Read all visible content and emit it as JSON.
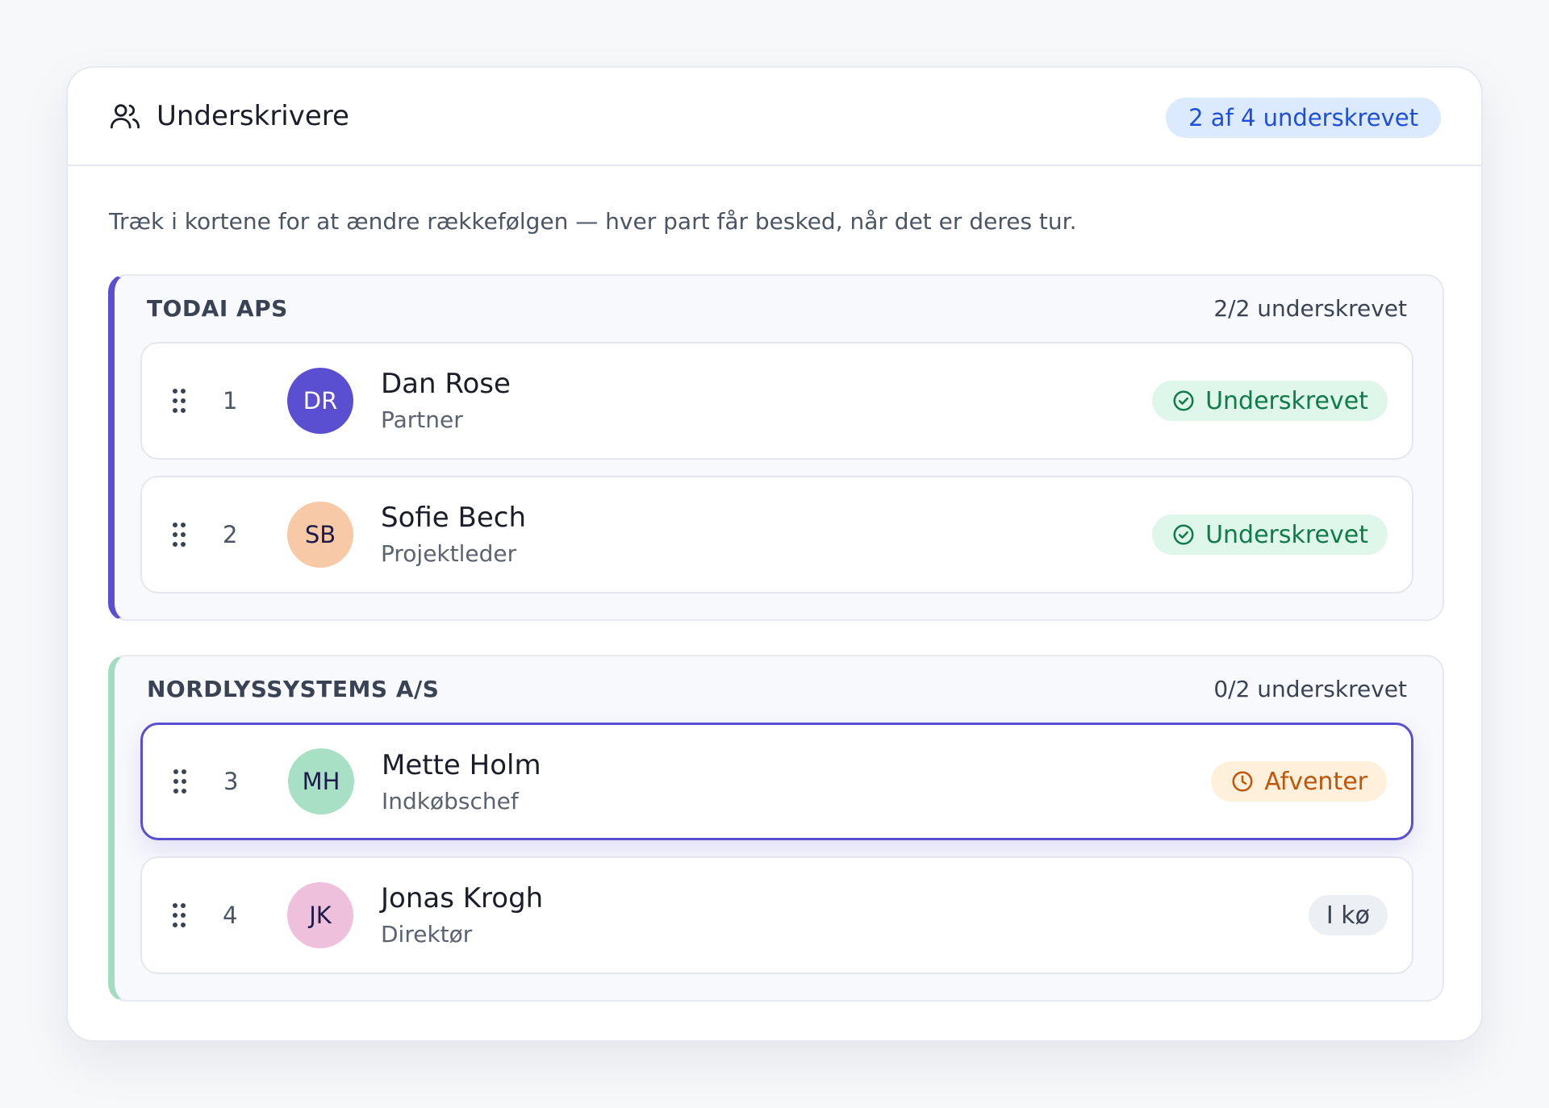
{
  "header": {
    "title": "Underskrivere",
    "progress_badge": "2 af 4 underskrevet",
    "icon": "users-icon"
  },
  "instructions": "Træk i kortene for at ændre rækkefølgen — hver part får besked, når det er deres tur.",
  "colors": {
    "accent": "#5b4fd1",
    "group2_accent": "#a3dcc0",
    "signed_text": "#0f7a4a",
    "signed_bg": "#dff6ea",
    "pending_text": "#c0560a",
    "pending_bg": "#fff0dc",
    "badge_text": "#1f4fd8",
    "badge_bg": "#dbeafe"
  },
  "groups": [
    {
      "name": "TODAI APS",
      "count": "2/2 underskrevet",
      "signers": [
        {
          "order": "1",
          "initials": "DR",
          "name": "Dan Rose",
          "role": "Partner",
          "status": "Underskrevet",
          "status_icon": "check-circle-icon",
          "avatar_bg": "#5b4fd1",
          "avatar_fg": "#ffffff"
        },
        {
          "order": "2",
          "initials": "SB",
          "name": "Sofie Bech",
          "role": "Projektleder",
          "status": "Underskrevet",
          "status_icon": "check-circle-icon",
          "avatar_bg": "#f8c9a6",
          "avatar_fg": "#1e1b4b"
        }
      ]
    },
    {
      "name": "NORDLYSSYSTEMS A/S",
      "count": "0/2 underskrevet",
      "signers": [
        {
          "order": "3",
          "initials": "MH",
          "name": "Mette Holm",
          "role": "Indkøbschef",
          "status": "Afventer",
          "status_icon": "clock-icon",
          "avatar_bg": "#a8e0c6",
          "avatar_fg": "#1e1b4b"
        },
        {
          "order": "4",
          "initials": "JK",
          "name": "Jonas Krogh",
          "role": "Direktør",
          "status": "I kø",
          "status_icon": "",
          "avatar_bg": "#efc0dc",
          "avatar_fg": "#1e1b4b"
        }
      ]
    }
  ]
}
